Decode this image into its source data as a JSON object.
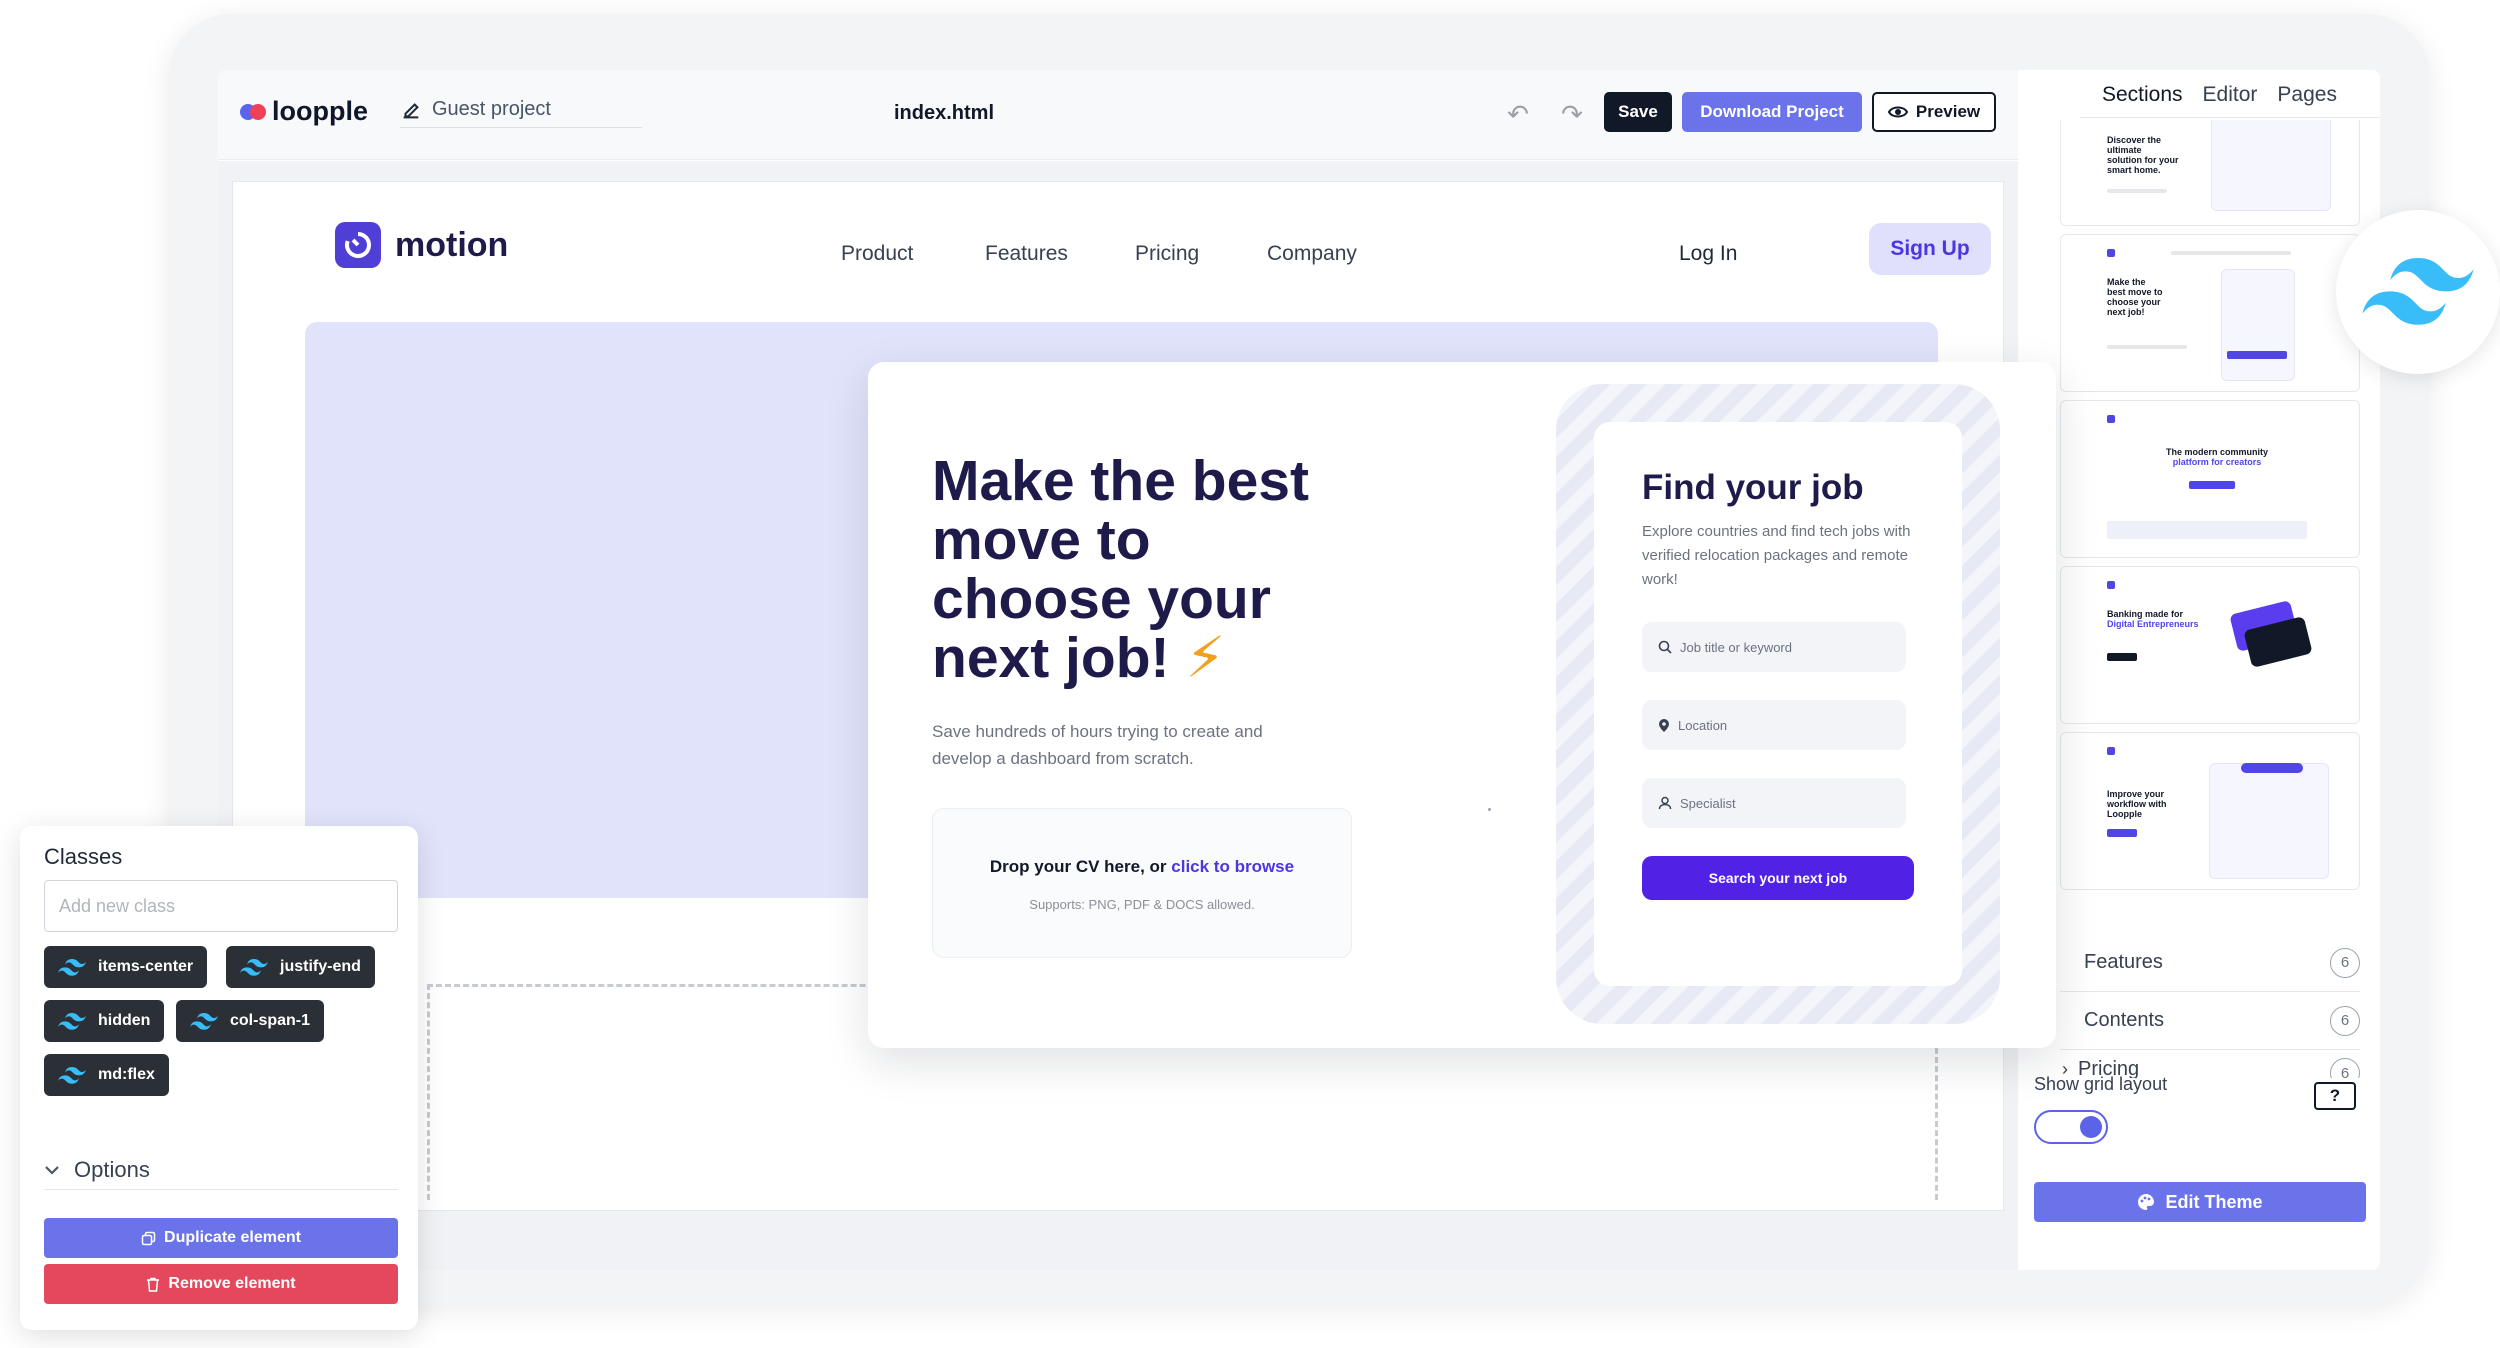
{
  "editor": {
    "brand": "loopple",
    "project": "Guest project",
    "file_name": "index.html",
    "buttons": {
      "save": "Save",
      "download": "Download Project",
      "preview": "Preview"
    },
    "panel_tabs": [
      "Sections",
      "Editor",
      "Pages"
    ],
    "colors": {
      "accent": "#6a73ea",
      "dark": "#111827",
      "danger": "#e4485c"
    }
  },
  "site": {
    "logo": "motion",
    "nav": [
      "Product",
      "Features",
      "Pricing",
      "Company"
    ],
    "login": "Log In",
    "signup": "Sign Up",
    "hero": {
      "title": "Make the best move to choose your next job!",
      "subtitle": "Save hundreds of hours trying to create and develop a dashboard from scratch.",
      "cv_text": "Drop your CV here, or",
      "cv_link": "click to browse",
      "cv_note": "Supports: PNG, PDF & DOCS allowed."
    },
    "job": {
      "title": "Find your job",
      "description": "Explore countries and find tech jobs with verified relocation packages and remote work!",
      "fields": [
        "Job title or keyword",
        "Location",
        "Specialist"
      ],
      "button": "Search your next job"
    },
    "colors": {
      "brand": "#4f3fd6",
      "hero_band": "#e1e3fb",
      "primary_button": "#5221e6"
    }
  },
  "sidebar": {
    "thumbnails": [
      {
        "lines": [
          "Discover the",
          "ultimate",
          "solution for your",
          "smart home."
        ]
      },
      {
        "lines": [
          "Make the",
          "best move to",
          "choose your",
          "next job!"
        ]
      },
      {
        "lines": [
          "The modern community",
          "platform for creators"
        ]
      },
      {
        "lines": [
          "Banking made for",
          "Digital Entrepreneurs"
        ]
      },
      {
        "lines": [
          "Improve your",
          "workflow with",
          "Loopple"
        ]
      }
    ],
    "categories": [
      {
        "label": "Features",
        "count": "6"
      },
      {
        "label": "Contents",
        "count": "6"
      },
      {
        "label": "Pricing",
        "count": "6"
      }
    ],
    "grid_label": "Show grid layout",
    "grid_enabled": true,
    "help": "?",
    "edit_theme": "Edit Theme"
  },
  "classes_panel": {
    "title": "Classes",
    "placeholder": "Add new class",
    "chips": [
      "items-center",
      "justify-end",
      "hidden",
      "col-span-1",
      "md:flex"
    ],
    "options": "Options",
    "duplicate": "Duplicate element",
    "remove": "Remove element"
  }
}
